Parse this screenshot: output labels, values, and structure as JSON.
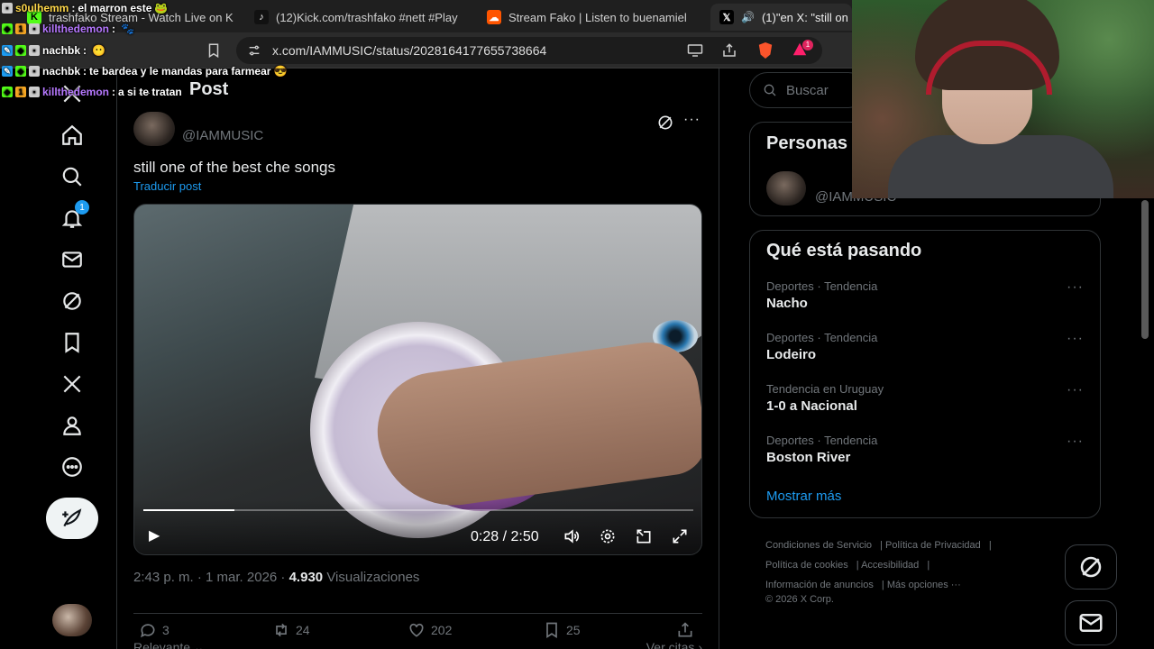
{
  "browser": {
    "tabs": [
      {
        "label": "trashfako Stream - Watch Live on K",
        "icon": "kick-icon"
      },
      {
        "label": "(12)Kick.com/trashfako #nett #Play",
        "icon": "tiktok-icon"
      },
      {
        "label": "Stream Fako | Listen to buenamiel",
        "icon": "soundcloud-icon"
      },
      {
        "label": "(1)\"en X: \"still on",
        "icon": "x-logo-icon"
      }
    ],
    "url": "x.com/IAMMUSIC/status/2028164177655738664",
    "shields_count": "1"
  },
  "chat": [
    {
      "user": "s0ulhemm",
      "message": "el marron este",
      "color": "#ffd84a"
    },
    {
      "user": "killthedemon",
      "message": "",
      "color": "#b678ff"
    },
    {
      "user": "nachbk",
      "message": "",
      "color": "#ffffff"
    },
    {
      "user": "nachbk",
      "message": "te bardea y le mandas para farmear",
      "color": "#ffffff"
    },
    {
      "user": "killthedemon",
      "message": "a si te tratan",
      "color": "#b678ff"
    }
  ],
  "sidebar": {
    "notifications_badge": "1"
  },
  "post": {
    "header": "Post",
    "handle": "@IAMMUSIC",
    "text": "still one of the best che songs",
    "translate": "Traducir post",
    "video": {
      "time": "0:28 / 2:50",
      "progress": 0.165
    },
    "time": "2:43 p. m. · 1 mar. 2026 ·",
    "views": "4.930",
    "views_label": "Visualizaciones",
    "replies": "3",
    "reposts": "24",
    "likes": "202",
    "bookmarks": "25",
    "relevant": "Relevante",
    "quotes": "Ver citas"
  },
  "right": {
    "search_placeholder": "Buscar",
    "people_title": "Personas",
    "people_handle": "@IAMMUSIC",
    "trends_title": "Qué está pasando",
    "trends": [
      {
        "category": "Deportes · Tendencia",
        "name": "Nacho"
      },
      {
        "category": "Deportes · Tendencia",
        "name": "Lodeiro"
      },
      {
        "category": "Tendencia en Uruguay",
        "name": "1-0 a Nacional"
      },
      {
        "category": "Deportes · Tendencia",
        "name": "Boston River"
      }
    ],
    "show_more": "Mostrar más",
    "footer": {
      "terms": "Condiciones de Servicio",
      "privacy": "Política de Privacidad",
      "cookies": "Política de cookies",
      "accessibility": "Accesibilidad",
      "ads": "Información de anuncios",
      "more": "Más opciones ···",
      "copyright": "© 2026 X Corp."
    }
  },
  "colors": {
    "accent": "#1d9bf0",
    "background": "#000000",
    "border": "#2f3336",
    "muted": "#71767b"
  }
}
